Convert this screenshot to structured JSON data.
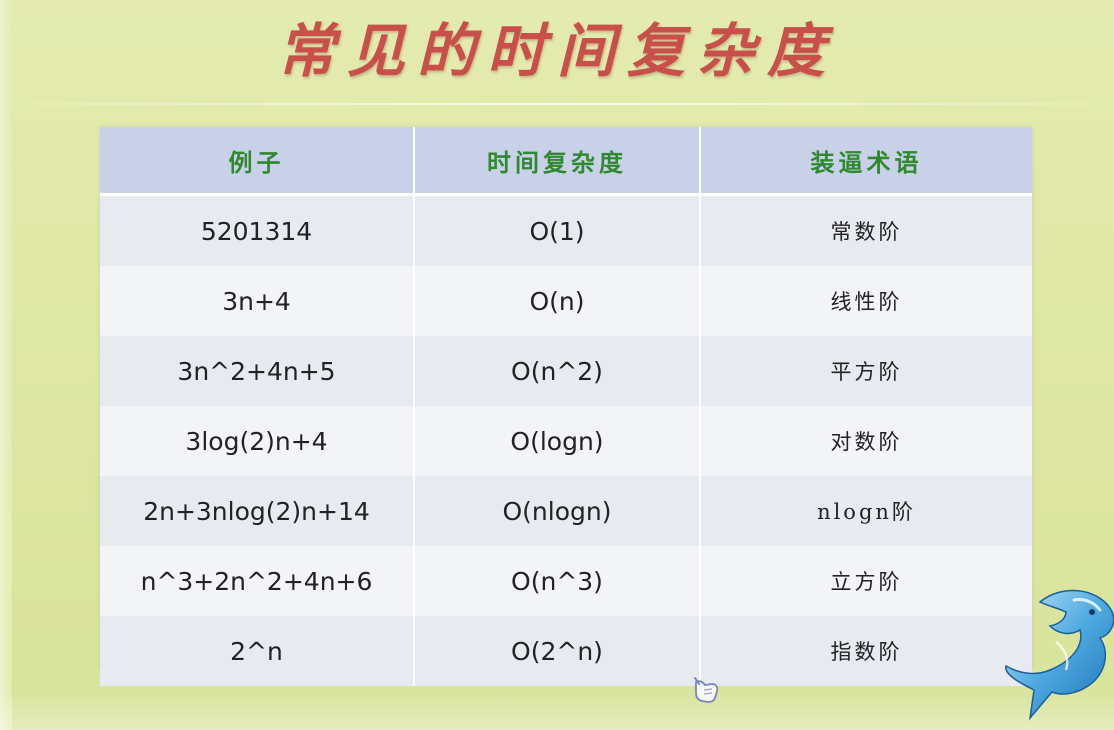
{
  "title": "常见的时间复杂度",
  "table": {
    "headers": [
      "例子",
      "时间复杂度",
      "装逼术语"
    ],
    "rows": [
      [
        "5201314",
        "O(1)",
        "常数阶"
      ],
      [
        "3n+4",
        "O(n)",
        "线性阶"
      ],
      [
        "3n^2+4n+5",
        "O(n^2)",
        "平方阶"
      ],
      [
        "3log(2)n+4",
        "O(logn)",
        "对数阶"
      ],
      [
        "2n+3nlog(2)n+14",
        "O(nlogn)",
        "nlogn阶"
      ],
      [
        "n^3+2n^2+4n+6",
        "O(n^3)",
        "立方阶"
      ],
      [
        "2^n",
        "O(2^n)",
        "指数阶"
      ]
    ]
  },
  "colors": {
    "background": "#dfe8a6",
    "title": "#c9504a",
    "header_bg": "#c9d1e9",
    "header_text": "#2f8a2f",
    "row_odd": "#e8eaf2",
    "row_even": "#f3f4f8"
  },
  "icons": {
    "cursor": "hand-pointer-icon",
    "logo": "dolphin-logo-icon"
  }
}
